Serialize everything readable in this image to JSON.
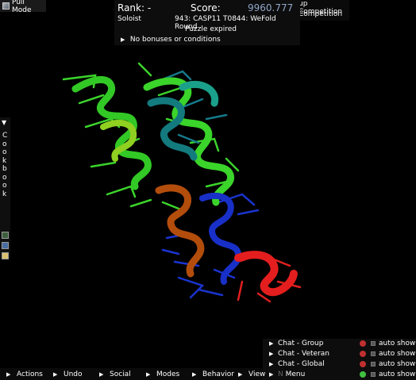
{
  "pull_mode": {
    "label": "Pull Mode"
  },
  "competition": {
    "line1": "up Competition",
    "line2": "Competition"
  },
  "score_panel": {
    "rank_label": "Rank: -",
    "score_label": "Score:",
    "score_value": "9960.777",
    "player_mode": "Soloist",
    "puzzle_title": "943: CASP11 T0844: WeFold Round",
    "status": "Puzzle expired",
    "conditions": "No bonuses or conditions"
  },
  "cookbook": {
    "title": "Cookbook",
    "letters": [
      "C",
      "o",
      "o",
      "k",
      "b",
      "o",
      "o",
      "k"
    ]
  },
  "chat": {
    "rows": [
      {
        "label": "Chat - Group",
        "dot_color": "#c03030",
        "auto": "auto show"
      },
      {
        "label": "Chat - Veteran",
        "dot_color": "#c03030",
        "auto": "auto show"
      },
      {
        "label": "Chat - Global",
        "dot_color": "#c03030",
        "auto": "auto show"
      },
      {
        "label": "Menu",
        "prefix": "N",
        "dot_color": "#40c040",
        "auto": "auto show"
      }
    ]
  },
  "bottom_bar": {
    "buttons": [
      {
        "label": "Actions"
      },
      {
        "label": "Undo"
      },
      {
        "label": "Social"
      },
      {
        "label": "Modes"
      },
      {
        "label": "Behavior"
      },
      {
        "label": "View"
      }
    ]
  },
  "colors": {
    "score": "#8fa6c8",
    "green_helix": "#3ad42a",
    "blue_helix": "#1830c8",
    "red_helix": "#e02020",
    "orange_helix": "#b05010",
    "teal_helix": "#157a7a"
  }
}
